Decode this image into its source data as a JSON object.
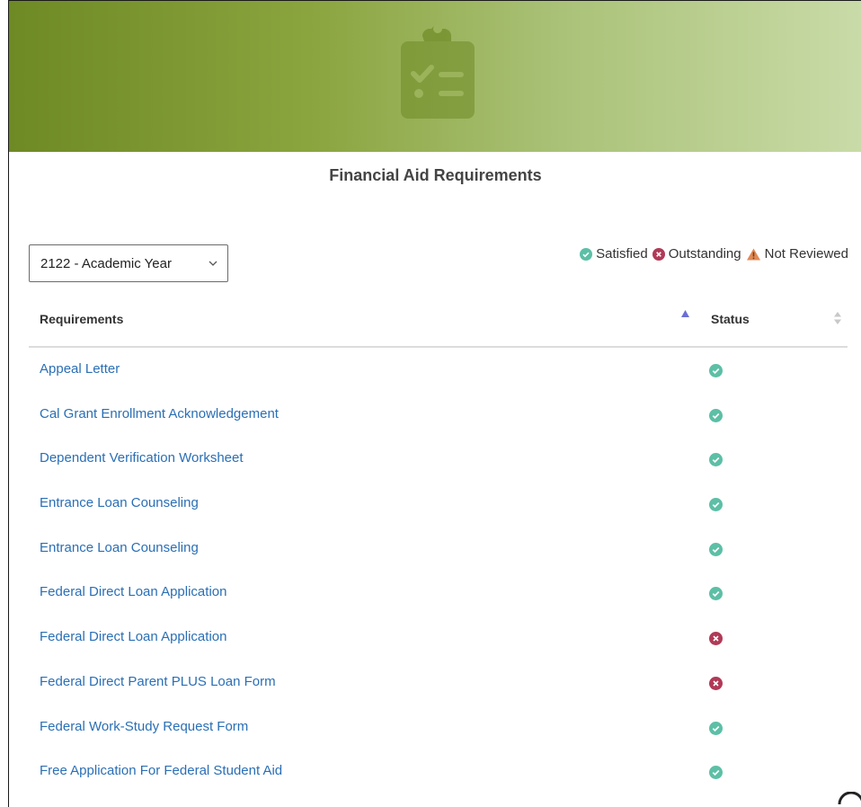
{
  "page": {
    "title": "Financial Aid Requirements"
  },
  "filter": {
    "selected": "2122 - Academic Year"
  },
  "legend": {
    "satisfied": "Satisfied",
    "outstanding": "Outstanding",
    "not_reviewed": "Not Reviewed"
  },
  "colors": {
    "banner_start": "#6e8a25",
    "banner_end": "#c9dba8",
    "link": "#2a6fb5",
    "satisfied": "#5cbfa6",
    "outstanding": "#b03a57",
    "not_reviewed": "#e08a56"
  },
  "table": {
    "headers": {
      "requirements": "Requirements",
      "status": "Status"
    },
    "rows": [
      {
        "name": "Appeal Letter",
        "status": "satisfied"
      },
      {
        "name": "Cal Grant Enrollment Acknowledgement",
        "status": "satisfied"
      },
      {
        "name": "Dependent Verification Worksheet",
        "status": "satisfied"
      },
      {
        "name": "Entrance Loan Counseling",
        "status": "satisfied"
      },
      {
        "name": "Entrance Loan Counseling",
        "status": "satisfied"
      },
      {
        "name": "Federal Direct Loan Application",
        "status": "satisfied"
      },
      {
        "name": "Federal Direct Loan Application",
        "status": "outstanding"
      },
      {
        "name": "Federal Direct Parent PLUS Loan Form",
        "status": "outstanding"
      },
      {
        "name": "Federal Work-Study Request Form",
        "status": "satisfied"
      },
      {
        "name": "Free Application For Federal Student Aid",
        "status": "satisfied"
      }
    ]
  },
  "icons": {
    "banner": "clipboard-checklist-icon",
    "satisfied": "check-circle-icon",
    "outstanding": "x-circle-icon",
    "not_reviewed": "warning-triangle-icon"
  }
}
